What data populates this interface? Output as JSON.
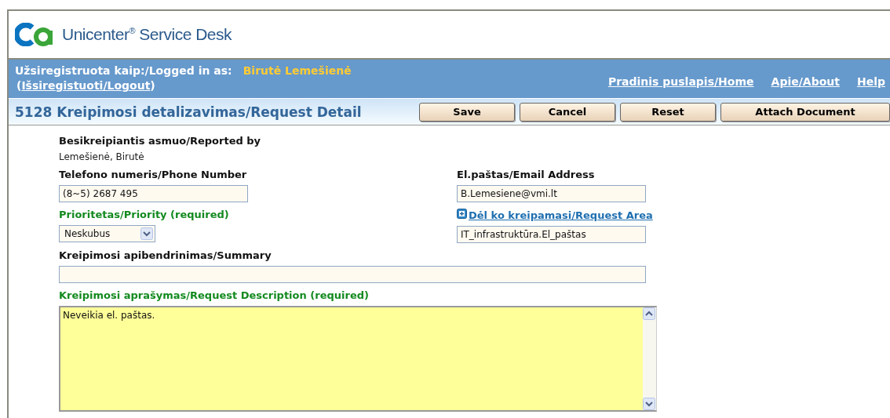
{
  "header": {
    "product": "Unicenter$^{®}$ Service Desk"
  },
  "user_bar": {
    "logged_in_label": "Užsiregistruota kaip:/Logged in as:",
    "user_name": "Birutė Lemešienė",
    "logout_open": "(",
    "logout_link": "Išsiregistuoti/Logout",
    "logout_close": ")",
    "nav_links": [
      "Pradinis puslapis/Home",
      "Apie/About",
      "Help"
    ]
  },
  "title_bar": {
    "title": "5128 Kreipimosi detalizavimas/Request Detail",
    "buttons": [
      "Save",
      "Cancel",
      "Reset",
      "Attach Document"
    ]
  },
  "form": {
    "reported_by": {
      "label": "Besikreipiantis asmuo/Reported by",
      "value": "Lemešienė, Birutė"
    },
    "phone": {
      "label": "Telefono numeris/Phone Number",
      "value": "(8~5) 2687 495",
      "required": false
    },
    "email": {
      "label": "El.paštas/Email Address",
      "value": "B.Lemesiene@vmi.lt",
      "required": false
    },
    "priority": {
      "label": "Prioritetas/Priority (required)",
      "value": "Neskubus",
      "required": true
    },
    "request_area": {
      "link": " Dėl ko kreipamasi/Request Area",
      "value": "IT_infrastruktūra.El_paštas"
    },
    "summary": {
      "label": "Kreipimosi apibendrinimas/Summary",
      "required": false
    },
    "description": {
      "label": "Kreipimosi aprašymas/Request Description (required)",
      "value": "Neveikia el. paštas.",
      "required": true
    }
  }
}
